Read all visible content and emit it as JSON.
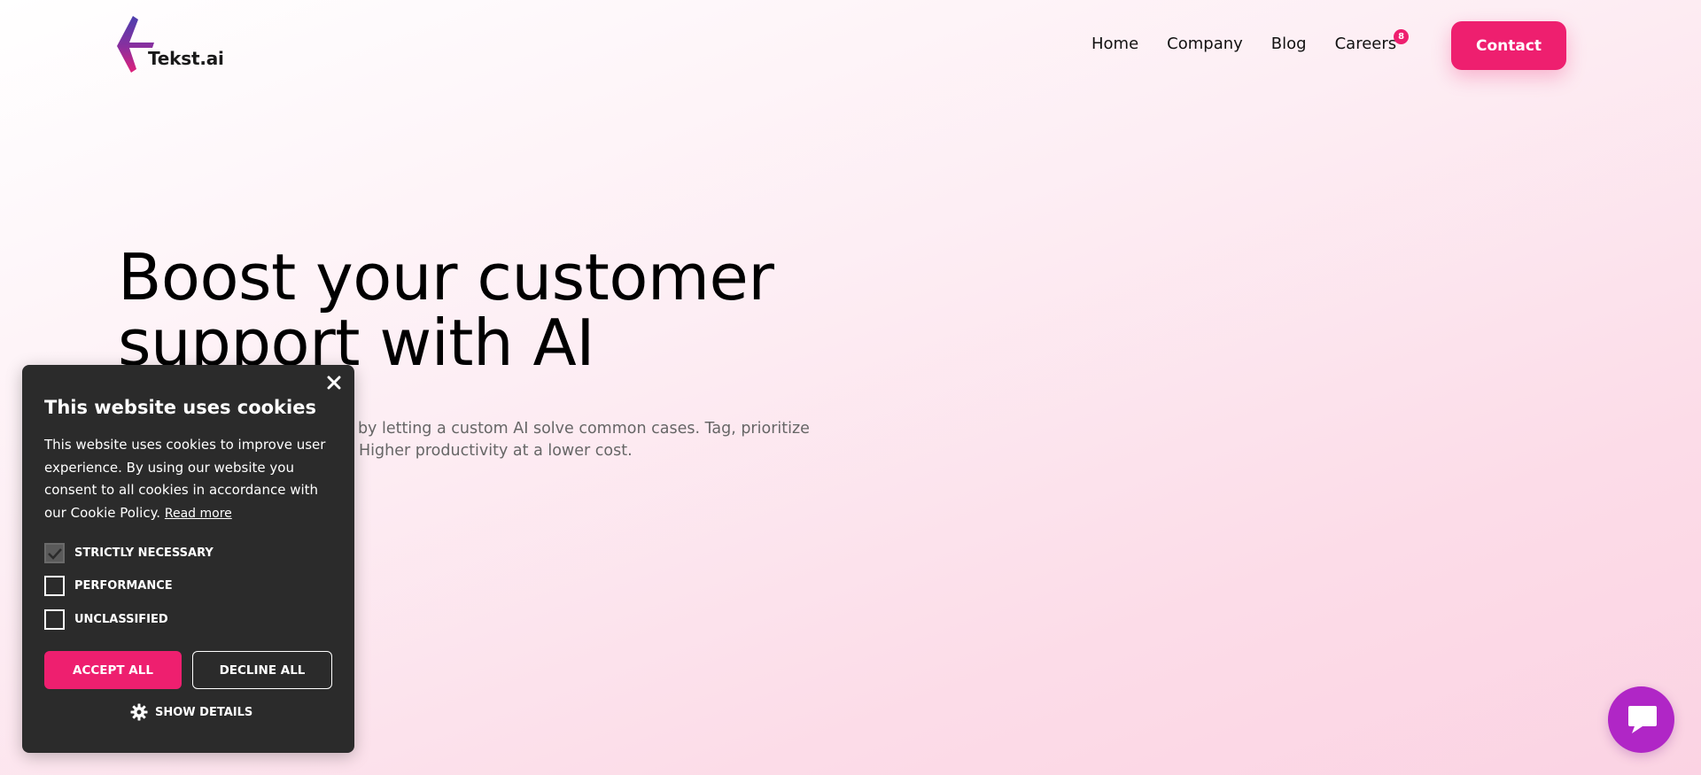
{
  "brand": {
    "name": "Tekst.ai",
    "accent_color": "#ee1f6f",
    "chat_color": "#b026c6"
  },
  "nav": {
    "items": [
      {
        "label": "Home"
      },
      {
        "label": "Company"
      },
      {
        "label": "Blog"
      },
      {
        "label": "Careers",
        "badge": "8"
      }
    ],
    "contact_label": "Contact"
  },
  "hero": {
    "title_line1": "Boost your customer",
    "title_line2": "support with AI",
    "subtitle_line1": "ce by letting a custom AI solve common cases. Tag, prioritize",
    "subtitle_line2": "Higher productivity at a lower cost."
  },
  "cookie": {
    "title": "This website uses cookies",
    "body": "This website uses cookies to improve user experience. By using our website you consent to all cookies in accordance with our Cookie Policy.",
    "read_more": "Read more",
    "options": [
      {
        "label": "STRICTLY NECESSARY",
        "checked": true
      },
      {
        "label": "PERFORMANCE",
        "checked": false
      },
      {
        "label": "UNCLASSIFIED",
        "checked": false
      }
    ],
    "accept_label": "ACCEPT ALL",
    "decline_label": "DECLINE ALL",
    "details_label": "SHOW DETAILS",
    "close_icon": "close-icon",
    "details_icon": "gear-icon"
  },
  "chat": {
    "icon": "chat-bubble-icon"
  }
}
